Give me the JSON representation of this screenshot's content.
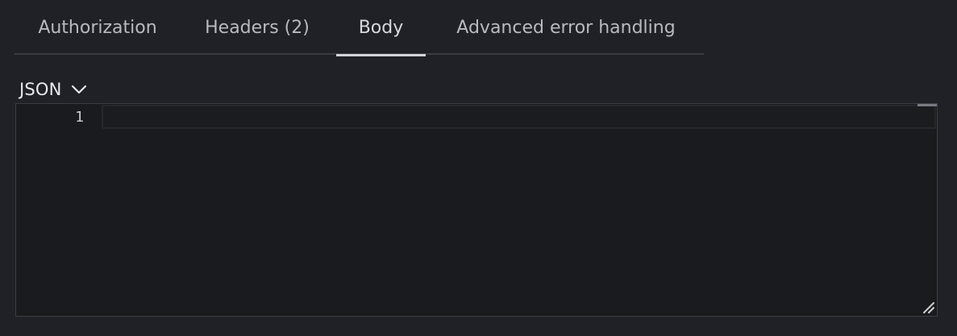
{
  "tabs": [
    {
      "label": "Authorization"
    },
    {
      "label": "Headers (2)"
    },
    {
      "label": "Body",
      "active": true
    },
    {
      "label": "Advanced error handling"
    }
  ],
  "body": {
    "format": "JSON"
  },
  "editor": {
    "line_numbers": [
      "1"
    ],
    "content": ""
  },
  "colors": {
    "background": "#202127",
    "editor_background": "#1a1b1f",
    "active_tab_indicator": "#d4d4d8",
    "text": "#e8e8ec"
  },
  "icons": {
    "format_dropdown": "chevron-down-icon",
    "editor_resize": "resize-handle-icon"
  }
}
